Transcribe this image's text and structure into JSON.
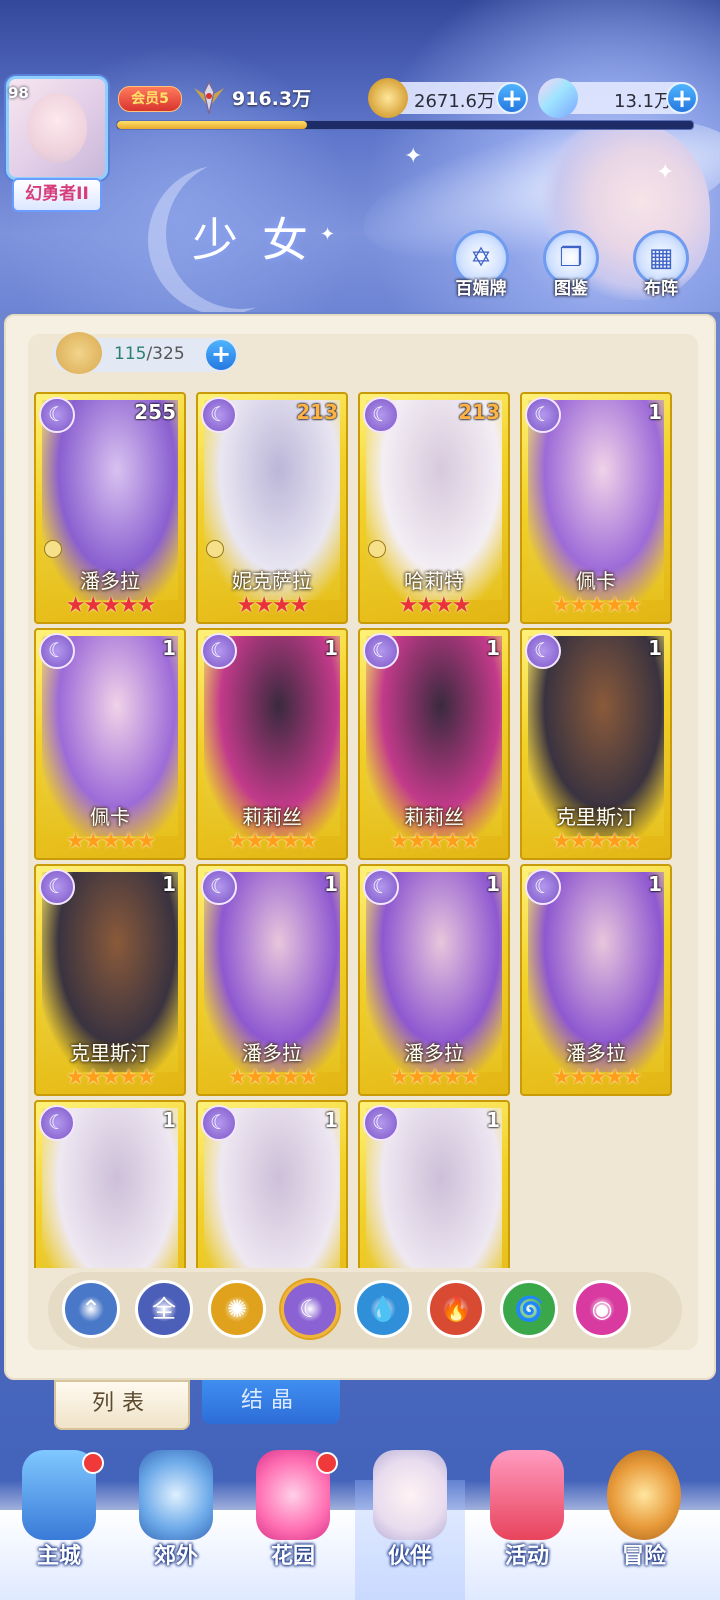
{
  "header": {
    "player_level": "98",
    "rank_title": "幻勇者II",
    "vip_label": "会员5",
    "power": "916.3万",
    "exp_progress": 0.33,
    "gold": "2671.6万",
    "crystals": "13.1万",
    "page_title": "少女",
    "buttons": [
      {
        "label": "百媚牌",
        "icon": "card-deck-icon"
      },
      {
        "label": "图鉴",
        "icon": "book-icon"
      },
      {
        "label": "布阵",
        "icon": "grid-icon"
      }
    ]
  },
  "capacity": {
    "current": "115",
    "max": "/325"
  },
  "cards": [
    {
      "count": "255",
      "name": "潘多拉",
      "stars": "★★★★★",
      "star_color": "red",
      "locked": true,
      "count_color": "white"
    },
    {
      "count": "213",
      "name": "妮克萨拉",
      "stars": "★★★★",
      "star_color": "red",
      "locked": true,
      "count_color": "orange"
    },
    {
      "count": "213",
      "name": "哈莉特",
      "stars": "★★★★",
      "star_color": "red",
      "locked": true,
      "count_color": "orange"
    },
    {
      "count": "1",
      "name": "佩卡",
      "stars": "★★★★★",
      "star_color": "gold",
      "locked": false,
      "count_color": "white"
    },
    {
      "count": "1",
      "name": "佩卡",
      "stars": "★★★★★",
      "star_color": "gold",
      "locked": false,
      "count_color": "white"
    },
    {
      "count": "1",
      "name": "莉莉丝",
      "stars": "★★★★★",
      "star_color": "gold",
      "locked": false,
      "count_color": "white"
    },
    {
      "count": "1",
      "name": "莉莉丝",
      "stars": "★★★★★",
      "star_color": "gold",
      "locked": false,
      "count_color": "white"
    },
    {
      "count": "1",
      "name": "克里斯汀",
      "stars": "★★★★★",
      "star_color": "gold",
      "locked": false,
      "count_color": "white"
    },
    {
      "count": "1",
      "name": "克里斯汀",
      "stars": "★★★★★",
      "star_color": "gold",
      "locked": false,
      "count_color": "white"
    },
    {
      "count": "1",
      "name": "潘多拉",
      "stars": "★★★★★",
      "star_color": "gold",
      "locked": false,
      "count_color": "white"
    },
    {
      "count": "1",
      "name": "潘多拉",
      "stars": "★★★★★",
      "star_color": "gold",
      "locked": false,
      "count_color": "white"
    },
    {
      "count": "1",
      "name": "潘多拉",
      "stars": "★★★★★",
      "star_color": "gold",
      "locked": false,
      "count_color": "white"
    },
    {
      "count": "1",
      "name": "",
      "stars": "",
      "star_color": "gold",
      "locked": false,
      "count_color": "white"
    },
    {
      "count": "1",
      "name": "",
      "stars": "",
      "star_color": "gold",
      "locked": false,
      "count_color": "white"
    },
    {
      "count": "1",
      "name": "",
      "stars": "",
      "star_color": "gold",
      "locked": false,
      "count_color": "white"
    }
  ],
  "filters": [
    {
      "icon": "wind-element-icon",
      "label": "",
      "color": "#4a78c8",
      "active": false
    },
    {
      "icon": "all-filter-icon",
      "label": "全",
      "color": "#4c5fb8",
      "active": false
    },
    {
      "icon": "sun-element-icon",
      "label": "",
      "color": "#e0a21d",
      "active": false
    },
    {
      "icon": "moon-element-icon",
      "label": "",
      "color": "#8a62d4",
      "active": true
    },
    {
      "icon": "water-element-icon",
      "label": "",
      "color": "#2f8fd8",
      "active": false
    },
    {
      "icon": "fire-element-icon",
      "label": "",
      "color": "#d84a32",
      "active": false
    },
    {
      "icon": "tornado-element-icon",
      "label": "",
      "color": "#3aa84a",
      "active": false
    },
    {
      "icon": "orb-element-icon",
      "label": "",
      "color": "#d83aa0",
      "active": false
    }
  ],
  "tabs": {
    "list": "列表",
    "crystal": "结晶"
  },
  "nav": [
    {
      "label": "主城",
      "icon": "castle-icon",
      "badge": true
    },
    {
      "label": "郊外",
      "icon": "portal-icon",
      "badge": false
    },
    {
      "label": "花园",
      "icon": "heart-icon",
      "badge": true
    },
    {
      "label": "伙伴",
      "icon": "partner-icon",
      "badge": false
    },
    {
      "label": "活动",
      "icon": "gift-icon",
      "badge": false
    },
    {
      "label": "冒险",
      "icon": "compass-icon",
      "badge": false
    }
  ],
  "colors": {
    "accent_blue": "#2578e0",
    "card_gold": "#f2d12a",
    "panel_bg": "#efe7d4"
  }
}
